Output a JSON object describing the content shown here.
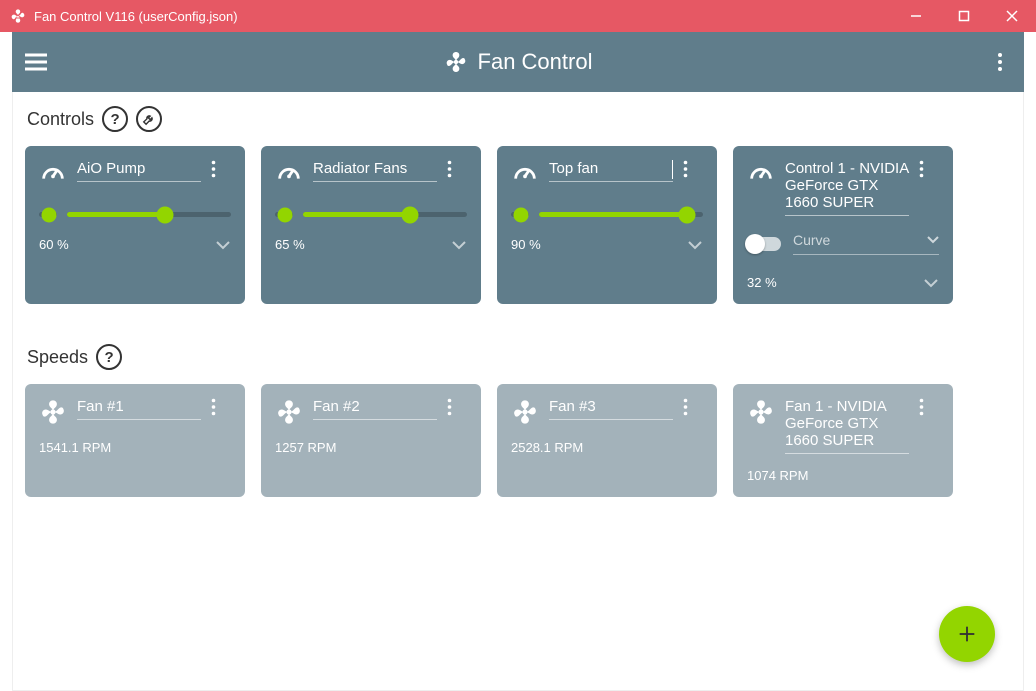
{
  "window": {
    "title": "Fan Control V116 (userConfig.json)"
  },
  "appbar": {
    "title": "Fan Control"
  },
  "sections": {
    "controls_label": "Controls",
    "speeds_label": "Speeds"
  },
  "controls": [
    {
      "name": "AiO Pump",
      "percent": 60,
      "percent_label": "60 %"
    },
    {
      "name": "Radiator Fans",
      "percent": 65,
      "percent_label": "65 %"
    },
    {
      "name": "Top fan",
      "percent": 90,
      "percent_label": "90 %",
      "editing": true
    },
    {
      "name": "Control 1 - NVIDIA GeForce GTX 1660 SUPER",
      "percent": 32,
      "percent_label": "32 %",
      "mode": "Curve",
      "is_gpu": true
    }
  ],
  "speeds": [
    {
      "name": "Fan #1",
      "rpm_label": "1541.1 RPM"
    },
    {
      "name": "Fan #2",
      "rpm_label": "1257 RPM"
    },
    {
      "name": "Fan #3",
      "rpm_label": "2528.1 RPM"
    },
    {
      "name": "Fan 1 - NVIDIA GeForce GTX 1660 SUPER",
      "rpm_label": "1074 RPM"
    }
  ],
  "colors": {
    "accent": "#93d500",
    "card_control": "#607d8b",
    "card_speed": "#a3b2ba",
    "titlebar": "#e65864"
  }
}
